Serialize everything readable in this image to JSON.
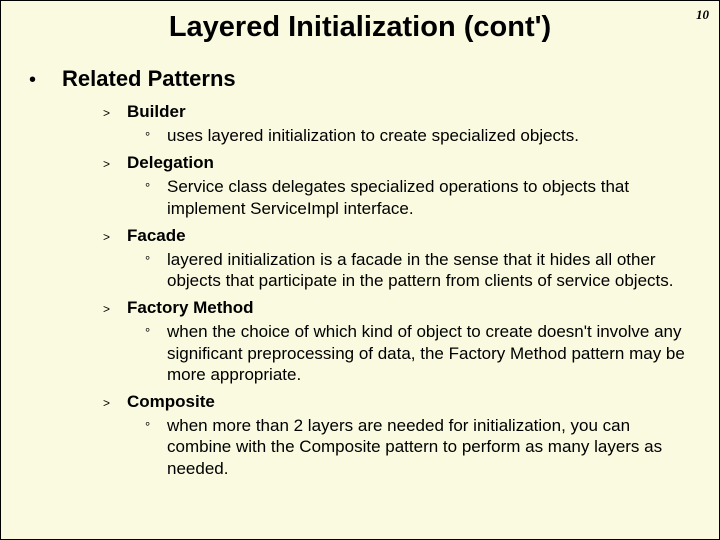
{
  "page_number": "10",
  "title": "Layered Initialization (cont')",
  "section": "Related Patterns",
  "bullets": {
    "level1": "•",
    "level2": ">",
    "level3": "°"
  },
  "patterns": [
    {
      "name": "Builder",
      "desc": "uses layered initialization to create specialized objects."
    },
    {
      "name": "Delegation",
      "desc": "Service class delegates specialized operations  to objects that implement ServiceImpl interface."
    },
    {
      "name": "Facade",
      "desc": "layered initialization is a facade in the sense that it hides all other objects that participate in the pattern from clients of service objects."
    },
    {
      "name": "Factory Method",
      "desc": "when the choice of which kind of object to create doesn't involve any significant preprocessing of data, the Factory Method pattern may be more appropriate."
    },
    {
      "name": "Composite",
      "desc": "when more than 2 layers are needed for initialization, you can combine with the Composite pattern to perform as many layers as needed."
    }
  ]
}
